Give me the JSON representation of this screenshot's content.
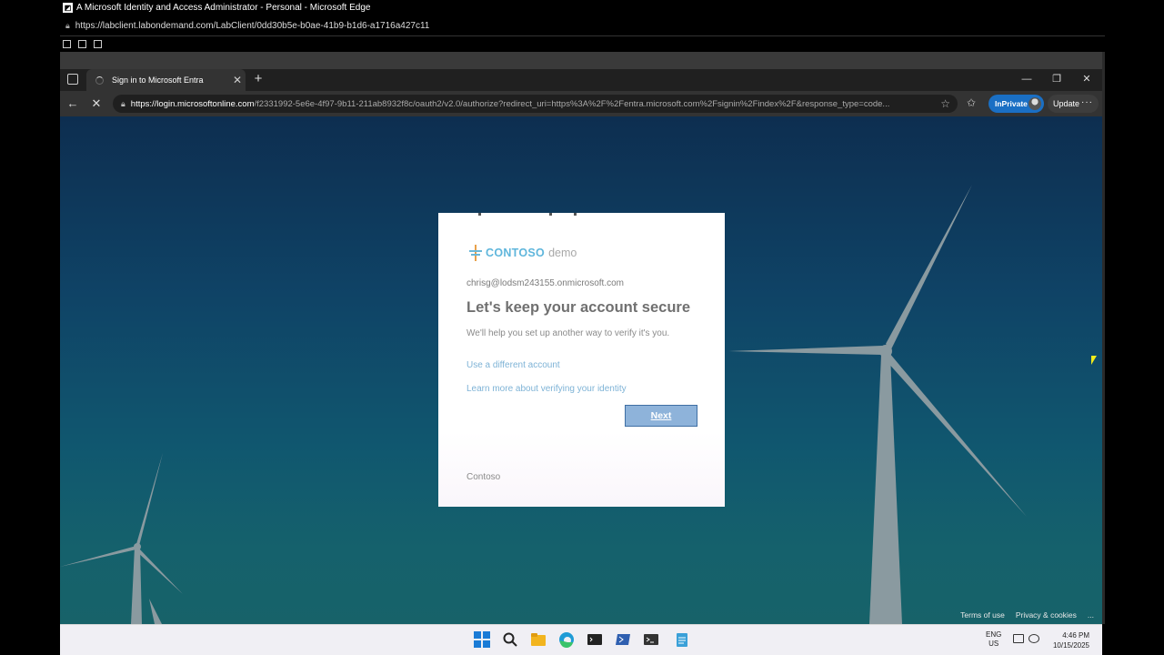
{
  "host_window": {
    "title": "A Microsoft Identity and Access Administrator - Personal - Microsoft Edge",
    "url": "https://labclient.labondemand.com/LabClient/0dd30b5e-b0ae-41b9-b1d6-a1716a427c11"
  },
  "browser": {
    "tab_title": "Sign in to Microsoft Entra",
    "address_host": "https://login.microsoftonline.com",
    "address_path": "/f2331992-5e6e-4f97-9b11-211ab8932f8c/oauth2/v2.0/authorize?redirect_uri=https%3A%2F%2Fentra.microsoft.com%2Fsignin%2Findex%2F&response_type=code...",
    "inprivate_label": "InPrivate",
    "update_label": "Update"
  },
  "card": {
    "brand_strong": "CONTOSO",
    "brand_light": "demo",
    "email": "chrisg@lodsm243155.onmicrosoft.com",
    "heading": "Let's keep your account secure",
    "description": "We'll help you set up another way to verify it's you.",
    "link_different_account": "Use a different account",
    "link_learn_more": "Learn more about verifying your identity",
    "next_label": "Next",
    "footer": "Contoso"
  },
  "page_footer": {
    "terms": "Terms of use",
    "privacy": "Privacy & cookies",
    "more": "..."
  },
  "taskbar": {
    "lang_line1": "ENG",
    "lang_line2": "US",
    "time": "4:46 PM",
    "date": "10/15/2025"
  },
  "colors": {
    "accent_inprivate": "#1a6fc4",
    "next_button": "#8eb3da",
    "link": "#7eb3d6",
    "brand": "#5fb6dc"
  }
}
